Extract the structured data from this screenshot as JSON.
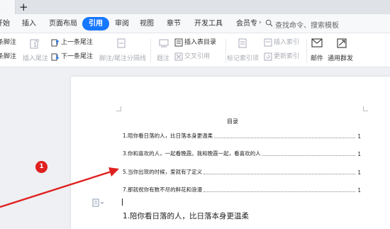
{
  "tabs": {
    "new_tab_symbol": "+"
  },
  "menu": {
    "items": [
      "开始",
      "插入",
      "页面布局",
      "引用",
      "审阅",
      "视图",
      "章节",
      "开发工具",
      "会员专"
    ],
    "active": "引用",
    "search_placeholder": "查找命令、搜索模板"
  },
  "ribbon": {
    "footnote": "条脚注",
    "next_footnote": "条脚注",
    "insert_endnote": "插入尾注",
    "prev_endnote": "上一条尾注",
    "next_endnote": "下一条尾注",
    "separator": "脚注/尾注分隔线",
    "caption": "题注",
    "insert_toc": "插入表目录",
    "cross_ref": "交叉引用",
    "mark_index": "标记索引项",
    "insert_index": "插入索引",
    "update_index": "更新索引",
    "mail": "邮件",
    "mass_mail": "通用群发"
  },
  "document": {
    "toc_title": "目录",
    "toc": [
      {
        "text": "1.陪你看日落的人，比日落本身更温柔",
        "page": "1"
      },
      {
        "text": "3.你和喜欢的人，一起看晚霞。我和晚霞一起，看喜欢的人",
        "page": "1"
      },
      {
        "text": "5.当你出现的时候，爱就有了定义",
        "page": "1"
      },
      {
        "text": "7.那就祝你有数不尽的鲜花和浪漫",
        "page": "1"
      }
    ],
    "heading1": "1.陪你看日落的人，比日落本身更温柔"
  },
  "annotation": {
    "badge": "1",
    "color": "#e02020"
  },
  "colors": {
    "accent": "#1677ff",
    "annotation": "#e02020"
  },
  "icons": [
    "search-icon",
    "footnote-icon",
    "endnote-icon",
    "separator-icon",
    "caption-icon",
    "toc-icon",
    "cross-reference-icon",
    "index-icon",
    "mail-icon",
    "mass-mail-icon",
    "paragraph-icon"
  ]
}
